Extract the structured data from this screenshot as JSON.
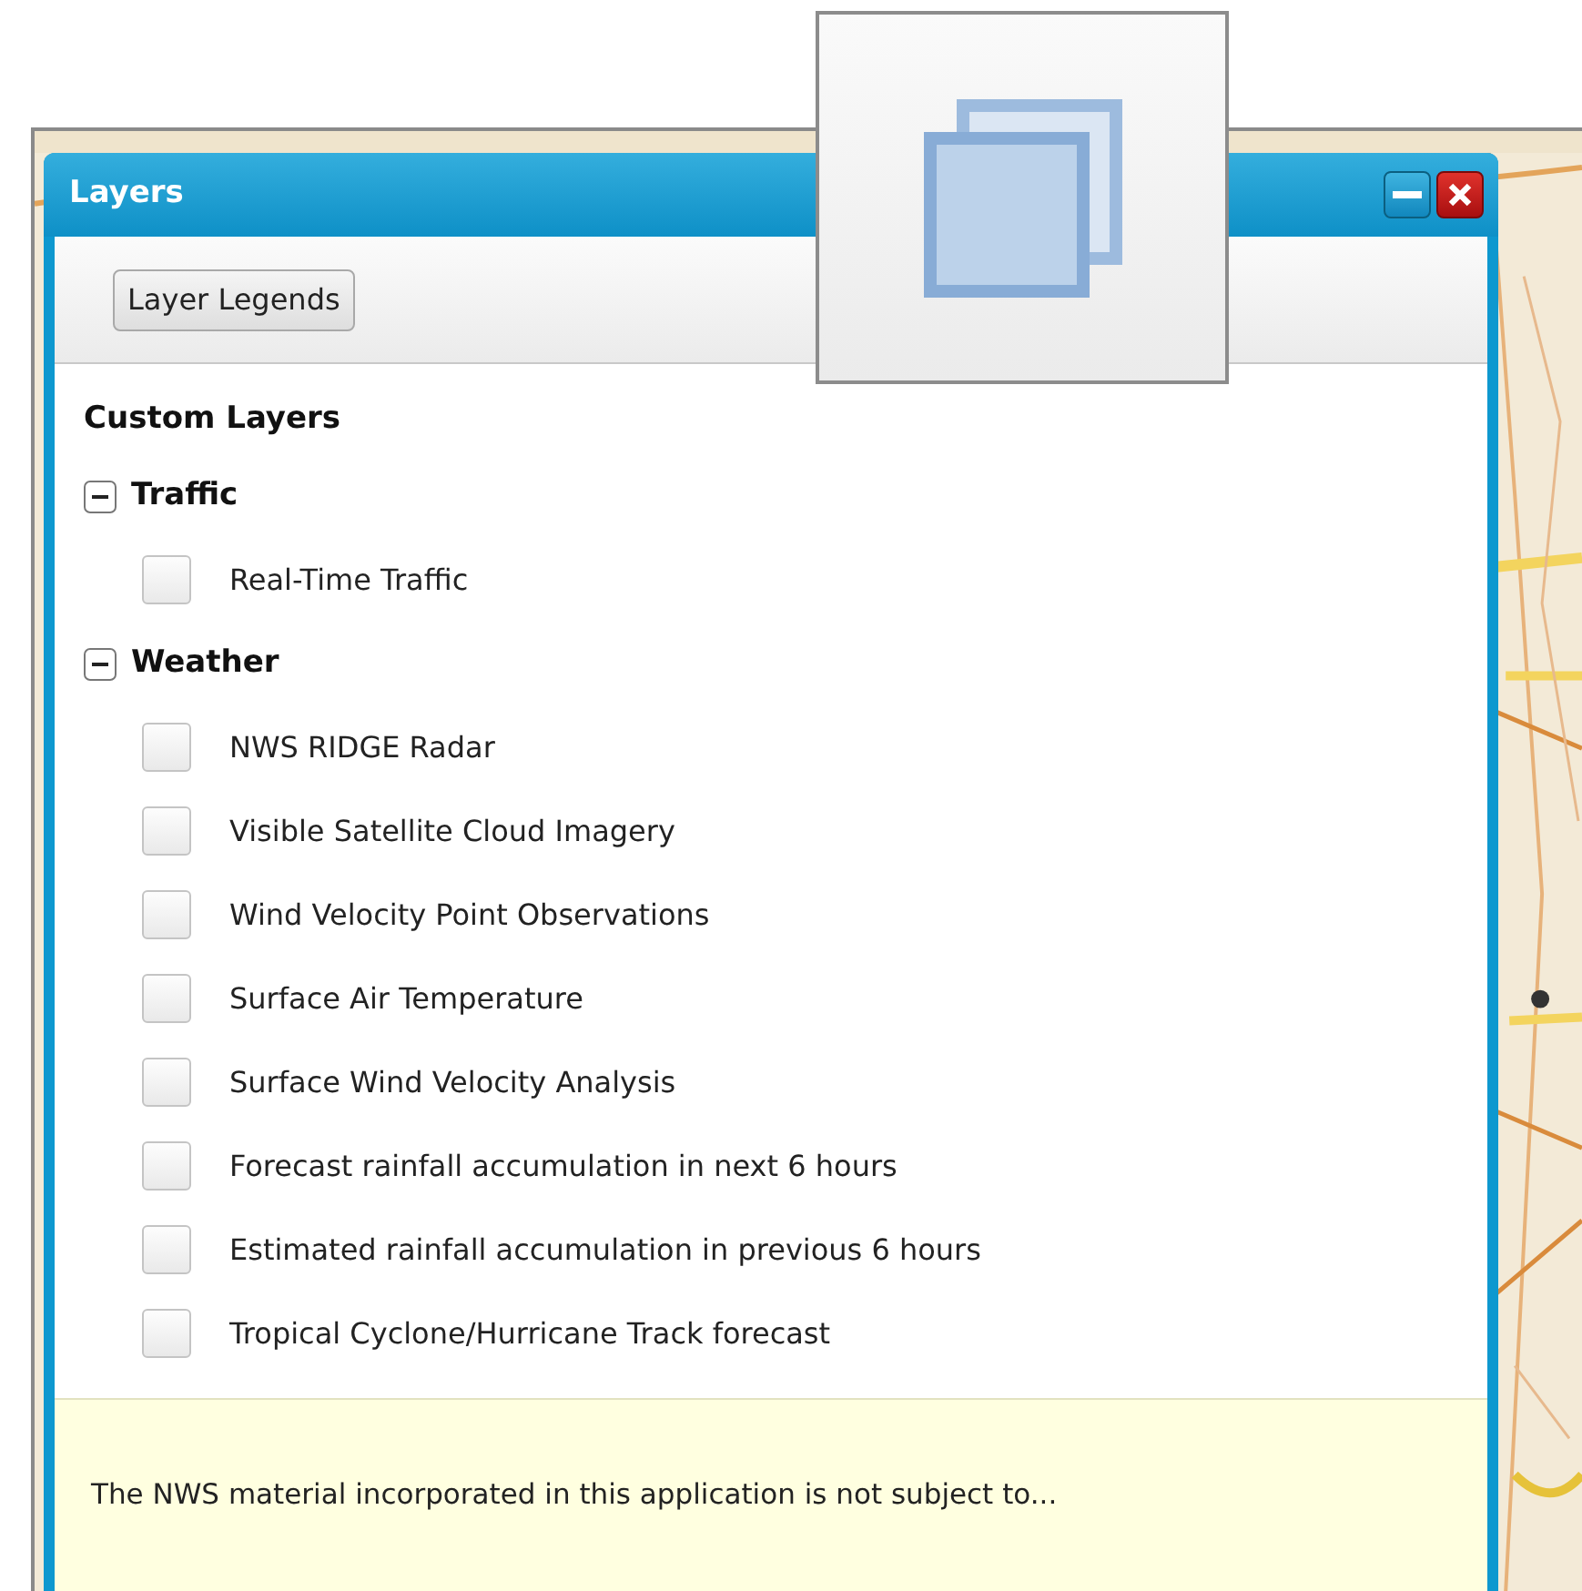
{
  "window": {
    "title": "Layers",
    "controls": [
      {
        "kind": "minimize"
      },
      {
        "kind": "close"
      }
    ]
  },
  "toolbar": {
    "buttons": [
      "Layer Legends"
    ]
  },
  "layers": {
    "heading": "Custom Layers",
    "groups": [
      {
        "label": "Traffic",
        "expanded": true,
        "children": [
          {
            "label": "Real-Time Traffic",
            "checked": false
          }
        ]
      },
      {
        "label": "Weather",
        "expanded": true,
        "children": [
          {
            "label": "NWS RIDGE Radar",
            "checked": false
          },
          {
            "label": "Visible Satellite Cloud Imagery",
            "checked": false
          },
          {
            "label": "Wind Velocity Point Observations",
            "checked": false
          },
          {
            "label": "Surface Air Temperature",
            "checked": false
          },
          {
            "label": "Surface Wind Velocity Analysis",
            "checked": false
          },
          {
            "label": "Forecast rainfall accumulation in next 6 hours",
            "checked": false
          },
          {
            "label": "Estimated rainfall accumulation in previous 6 hours",
            "checked": false
          },
          {
            "label": "Tropical Cyclone/Hurricane Track forecast",
            "checked": false
          }
        ]
      }
    ]
  },
  "footer": {
    "notice": "The NWS material incorporated in this application is not subject to..."
  }
}
